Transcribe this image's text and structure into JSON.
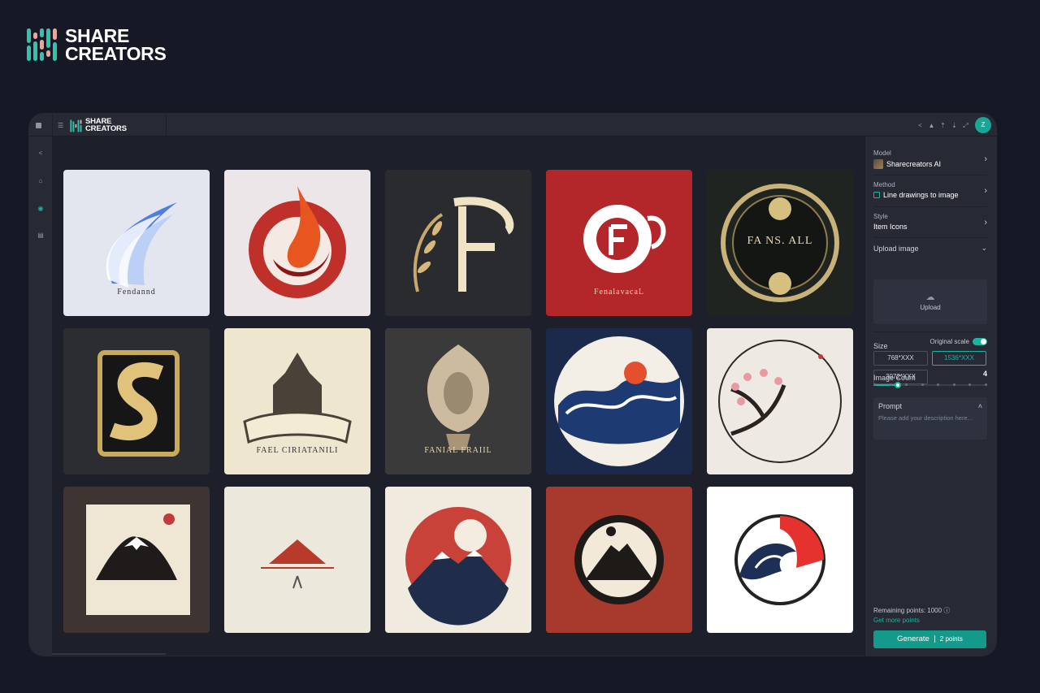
{
  "brand": {
    "line1": "SHARE",
    "line2": "CREATORS"
  },
  "topbar": {
    "mini_line1": "SHARE",
    "mini_line2": "CREATORS",
    "avatar_initial": "Z"
  },
  "panel": {
    "model_label": "Model",
    "model_value": "Sharecreators AI",
    "method_label": "Method",
    "method_value": "Line drawings to image",
    "style_label": "Style",
    "style_value": "Item Icons",
    "upload_label": "Upload image",
    "upload_button": "Upload",
    "size_label": "Size",
    "original_scale": "Original scale",
    "sizes": [
      "768*XXX",
      "1536*XXX",
      "3072*XXX"
    ],
    "image_count_label": "Image Count",
    "image_count": "4",
    "image_count_max": 8,
    "prompt_label": "Prompt",
    "prompt_placeholder": "Please add your description here...",
    "remaining_points": "Remaining points: 1000",
    "get_more": "Get more points",
    "generate": "Generate",
    "generate_cost": "2 points"
  },
  "gallery": {
    "tiles": [
      {
        "name": "feather-swoosh-logo",
        "bg": "#e3e6ee",
        "caption": "Fendannd"
      },
      {
        "name": "fire-circle-logo",
        "bg": "#ece6e8",
        "caption": ""
      },
      {
        "name": "laurel-f-logo",
        "bg": "#2a2b2f",
        "caption": ""
      },
      {
        "name": "red-f-emblem-logo",
        "bg": "#b3262a",
        "caption": "FenalavacaL"
      },
      {
        "name": "ornate-gold-badge-logo",
        "bg": "#1f2420",
        "caption": "FA NS. ALL"
      },
      {
        "name": "gold-s-crest-logo",
        "bg": "#2b2d31",
        "caption": ""
      },
      {
        "name": "castle-banner-logo",
        "bg": "#eee6cf",
        "caption": "FAEL CIRIATANILI"
      },
      {
        "name": "lion-crest-logo",
        "bg": "#3a3a3a",
        "caption": "FANIAL FRAIIL"
      },
      {
        "name": "wave-circle-logo",
        "bg": "#1b2a4a",
        "caption": ""
      },
      {
        "name": "cherry-blossom-logo",
        "bg": "#efe9e4",
        "caption": ""
      },
      {
        "name": "mountain-framed-logo",
        "bg": "#3e3532",
        "caption": ""
      },
      {
        "name": "red-mountain-logo",
        "bg": "#ece8dc",
        "caption": ""
      },
      {
        "name": "fuji-sun-logo",
        "bg": "#f1ebdf",
        "caption": ""
      },
      {
        "name": "dark-circle-mountain-logo",
        "bg": "#a8392d",
        "caption": ""
      },
      {
        "name": "red-wave-logo",
        "bg": "#ffffff",
        "caption": ""
      }
    ]
  }
}
